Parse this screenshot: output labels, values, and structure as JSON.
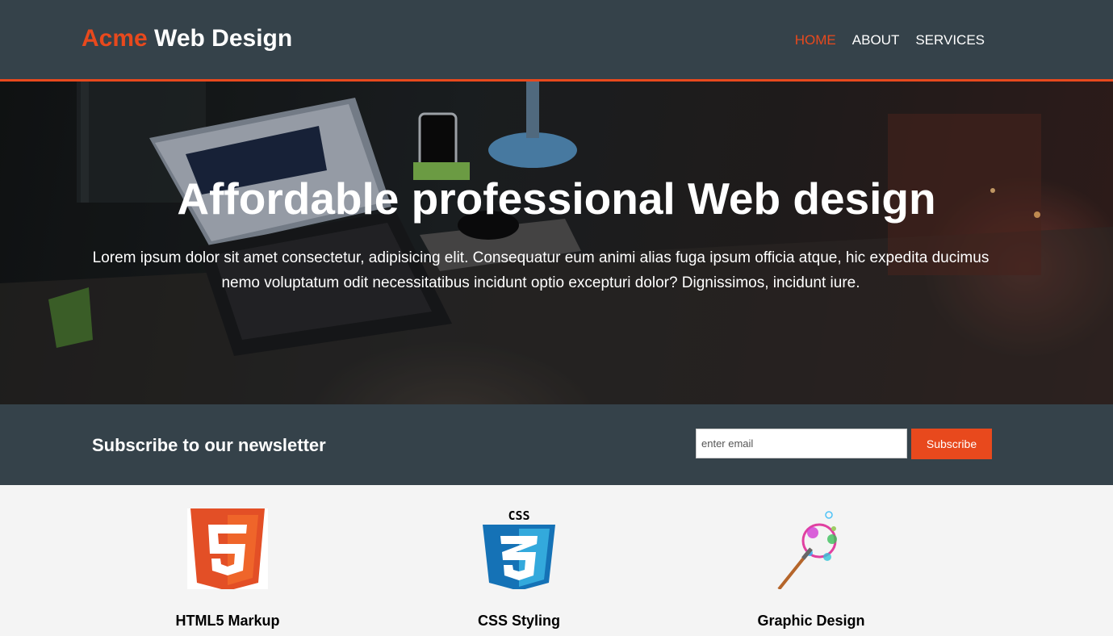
{
  "header": {
    "brand_highlight": "Acme",
    "brand_rest": " Web Design",
    "nav": [
      {
        "label": "HOME",
        "current": true
      },
      {
        "label": "ABOUT",
        "current": false
      },
      {
        "label": "SERVICES",
        "current": false
      }
    ],
    "accent_color": "#e8491d",
    "bg_color": "#35424a"
  },
  "showcase": {
    "title": "Affordable professional Web design",
    "text": "Lorem ipsum dolor sit amet consectetur, adipisicing elit. Consequatur eum animi alias fuga ipsum officia atque, hic expedita ducimus nemo voluptatum odit necessitatibus incidunt optio excepturi dolor? Dignissimos, incidunt iure."
  },
  "newsletter": {
    "heading": "Subscribe to our newsletter",
    "email_placeholder": "enter email",
    "button_label": "Subscribe"
  },
  "boxes": [
    {
      "title": "HTML5 Markup",
      "icon": "html5-logo-icon"
    },
    {
      "title": "CSS Styling",
      "icon": "css3-logo-icon"
    },
    {
      "title": "Graphic Design",
      "icon": "paintbrush-splash-icon"
    }
  ]
}
